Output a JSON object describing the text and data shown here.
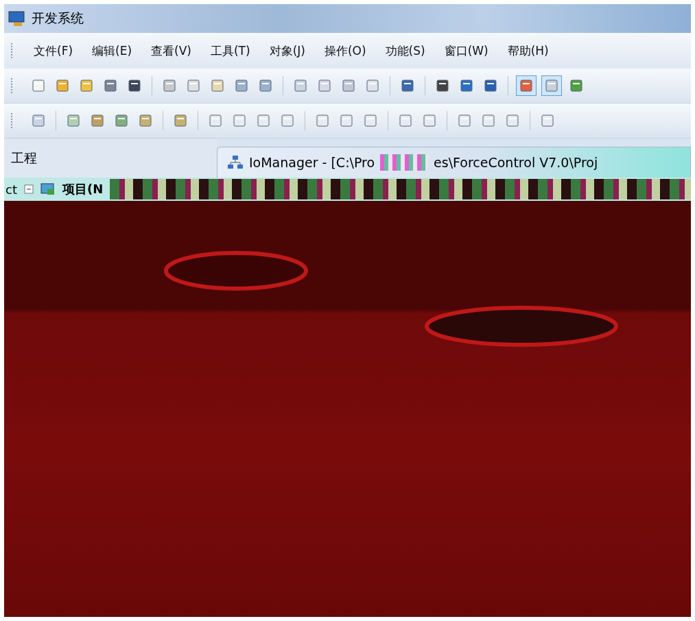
{
  "window": {
    "title": "开发系统"
  },
  "menu": [
    "文件(F)",
    "编辑(E)",
    "查看(V)",
    "工具(T)",
    "对象(J)",
    "操作(O)",
    "功能(S)",
    "窗口(W)",
    "帮助(H)"
  ],
  "project_panel": {
    "title": "工程",
    "tree_prefix": "ct",
    "tree_item": "项目(N"
  },
  "child_window": {
    "title_start": "IoManager - [C:\\Pro",
    "title_end": "es\\ForceControl V7.0\\Proj"
  }
}
